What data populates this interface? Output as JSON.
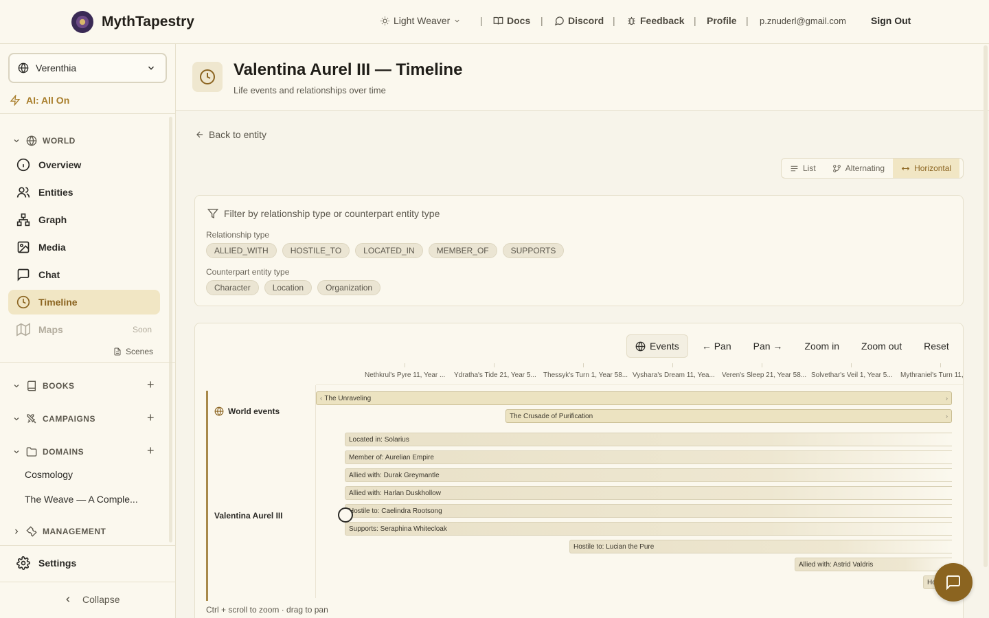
{
  "app": {
    "name": "MythTapestry"
  },
  "topnav": {
    "theme": "Light Weaver",
    "docs": "Docs",
    "discord": "Discord",
    "feedback": "Feedback",
    "profile": "Profile",
    "email": "p.znuderl@gmail.com",
    "signout": "Sign Out",
    "separator": "|"
  },
  "sidebar": {
    "world": "Verenthia",
    "ai_status": "AI: All On",
    "world_section": "WORLD",
    "items": [
      {
        "label": "Overview",
        "icon": "info-icon"
      },
      {
        "label": "Entities",
        "icon": "users-icon"
      },
      {
        "label": "Graph",
        "icon": "graph-icon"
      },
      {
        "label": "Media",
        "icon": "image-icon"
      },
      {
        "label": "Chat",
        "icon": "chat-icon"
      },
      {
        "label": "Timeline",
        "icon": "clock-icon",
        "active": true
      },
      {
        "label": "Maps",
        "icon": "map-icon",
        "badge": "Soon"
      }
    ],
    "scenes": "Scenes",
    "books": "BOOKS",
    "campaigns": "CAMPAIGNS",
    "domains": "DOMAINS",
    "domain_items": [
      "Cosmology",
      "The Weave — A Comple..."
    ],
    "management": "MANAGEMENT",
    "settings": "Settings",
    "collapse": "Collapse"
  },
  "header": {
    "title": "Valentina Aurel III — Timeline",
    "subtitle": "Life events and relationships over time"
  },
  "back": "Back to entity",
  "view_modes": {
    "list": "List",
    "alternating": "Alternating",
    "horizontal": "Horizontal",
    "selected": "Horizontal"
  },
  "filters": {
    "title": "Filter by relationship type or counterpart entity type",
    "rel_label": "Relationship type",
    "rel_types": [
      "ALLIED_WITH",
      "HOSTILE_TO",
      "LOCATED_IN",
      "MEMBER_OF",
      "SUPPORTS"
    ],
    "cp_label": "Counterpart entity type",
    "cp_types": [
      "Character",
      "Location",
      "Organization"
    ]
  },
  "timeline": {
    "toolbar": {
      "events": "Events",
      "pan_left": "← Pan",
      "pan_right": "Pan →",
      "zoom_in": "Zoom in",
      "zoom_out": "Zoom out",
      "reset": "Reset"
    },
    "axis_labels": [
      "Nethkrul's Pyre 11, Year ...",
      "Ydratha's Tide 21, Year 5...",
      "Thessyk's Turn 1, Year 58...",
      "Vyshara's Dream 11, Yea...",
      "Veren's Sleep 21, Year 58...",
      "Solvethar's Veil 1, Year 5...",
      "Mythraniel's Turn 11,"
    ],
    "lanes": {
      "world": "World events",
      "entity": "Valentina Aurel III"
    },
    "world_events": [
      {
        "label": "The Unraveling",
        "start_marker": "‹",
        "end_marker": "›"
      },
      {
        "label": "The Crusade of Purification",
        "end_marker": "›"
      }
    ],
    "relationships": [
      "Located in: Solarius",
      "Member of: Aurelian Empire",
      "Allied with: Durak Greymantle",
      "Allied with: Harlan Duskhollow",
      "Hostile to: Caelindra Rootsong",
      "Supports: Seraphina Whitecloak",
      "Hostile to: Lucian the Pure",
      "Allied with: Astrid Valdris",
      "Ho"
    ],
    "hint": "Ctrl + scroll to zoom · drag to pan"
  },
  "colors": {
    "accent": "#8b6420",
    "active_bg": "#f1e6c4",
    "lane": "#a8894a"
  }
}
